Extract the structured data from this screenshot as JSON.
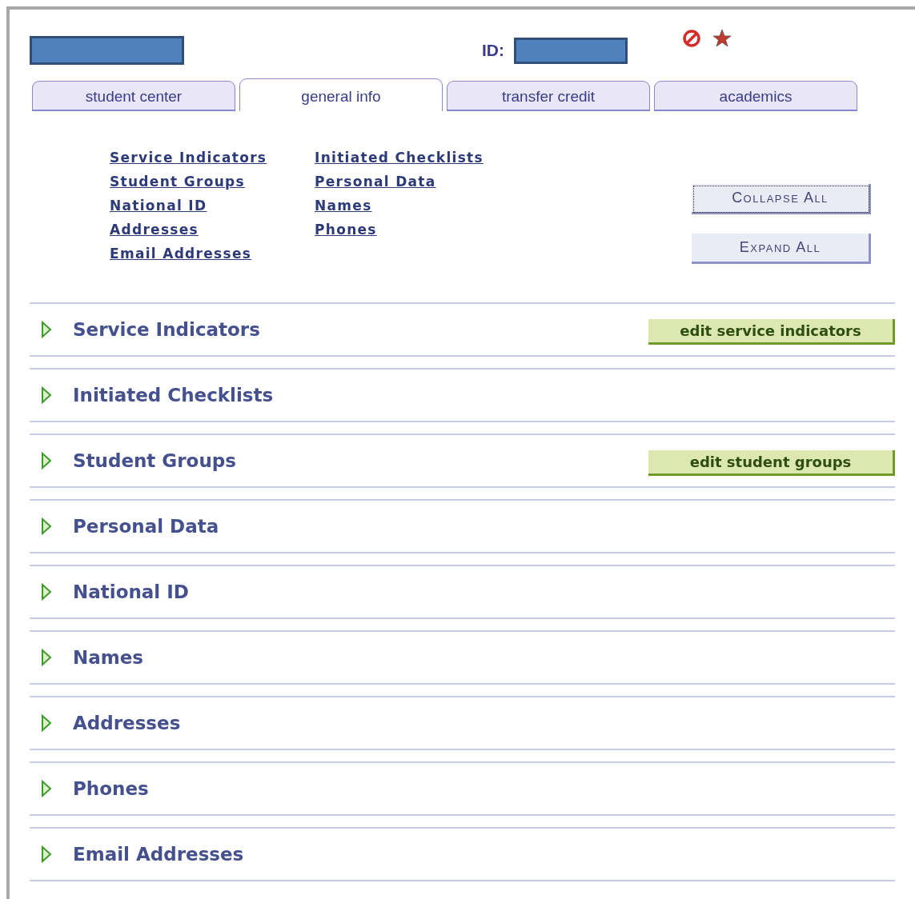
{
  "header": {
    "id_label": "ID:"
  },
  "tabs": [
    {
      "label": "student center",
      "selected": false
    },
    {
      "label": "general info",
      "selected": true
    },
    {
      "label": "transfer credit",
      "selected": false
    },
    {
      "label": "academics",
      "selected": false
    }
  ],
  "quick_links": [
    [
      "Service Indicators",
      "Student Groups",
      "National ID",
      "Addresses",
      "Email Addresses"
    ],
    [
      "Initiated Checklists",
      "Personal Data",
      "Names",
      "Phones"
    ]
  ],
  "buttons": [
    "Collapse All",
    "Expand All"
  ],
  "sections": [
    {
      "title": "Service Indicators",
      "expanded": false,
      "action": "edit service indicators"
    },
    {
      "title": "Initiated Checklists",
      "expanded": false
    },
    {
      "title": "Student Groups",
      "expanded": false,
      "action": "edit student groups"
    },
    {
      "title": "Personal Data",
      "expanded": false
    },
    {
      "title": "National ID",
      "expanded": false
    },
    {
      "title": "Names",
      "expanded": false
    },
    {
      "title": "Addresses",
      "expanded": false
    },
    {
      "title": "Phones",
      "expanded": false
    },
    {
      "title": "Email Addresses",
      "expanded": false
    }
  ]
}
